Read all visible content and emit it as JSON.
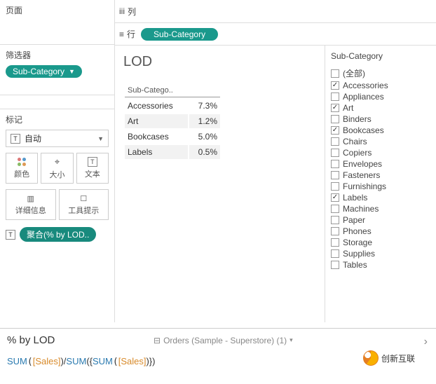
{
  "leftPanels": {
    "pages": "页面",
    "filters": "筛选器",
    "filterPill": "Sub-Category",
    "marks": "标记",
    "marksType": "自动",
    "cells": {
      "color": "颜色",
      "size": "大小",
      "text": "文本",
      "detail": "详细信息",
      "tooltip": "工具提示"
    },
    "aggPill": "聚合(% by LOD.."
  },
  "shelves": {
    "columns": "列",
    "rows": "行",
    "rowPill": "Sub-Category"
  },
  "viz": {
    "title": "LOD",
    "header": "Sub-Catego..",
    "rows": [
      {
        "label": "Accessories",
        "value": "7.3%"
      },
      {
        "label": "Art",
        "value": "1.2%"
      },
      {
        "label": "Bookcases",
        "value": "5.0%"
      },
      {
        "label": "Labels",
        "value": "0.5%"
      }
    ]
  },
  "filterPanel": {
    "title": "Sub-Category",
    "items": [
      {
        "label": "(全部)",
        "checked": false
      },
      {
        "label": "Accessories",
        "checked": true
      },
      {
        "label": "Appliances",
        "checked": false
      },
      {
        "label": "Art",
        "checked": true
      },
      {
        "label": "Binders",
        "checked": false
      },
      {
        "label": "Bookcases",
        "checked": true
      },
      {
        "label": "Chairs",
        "checked": false
      },
      {
        "label": "Copiers",
        "checked": false
      },
      {
        "label": "Envelopes",
        "checked": false
      },
      {
        "label": "Fasteners",
        "checked": false
      },
      {
        "label": "Furnishings",
        "checked": false
      },
      {
        "label": "Labels",
        "checked": true
      },
      {
        "label": "Machines",
        "checked": false
      },
      {
        "label": "Paper",
        "checked": false
      },
      {
        "label": "Phones",
        "checked": false
      },
      {
        "label": "Storage",
        "checked": false
      },
      {
        "label": "Supplies",
        "checked": false
      },
      {
        "label": "Tables",
        "checked": false
      }
    ]
  },
  "formula": {
    "name": "% by LOD",
    "source": "Orders (Sample - Superstore) (1)",
    "expr": {
      "fn1": "SUM",
      "f1": "[Sales]",
      "sep": ")/",
      "fn2": "SUM",
      "lb": "({",
      "fn3": "SUM",
      "f2": "[Sales]",
      "rb": ")})"
    }
  },
  "watermark": "创新互联"
}
